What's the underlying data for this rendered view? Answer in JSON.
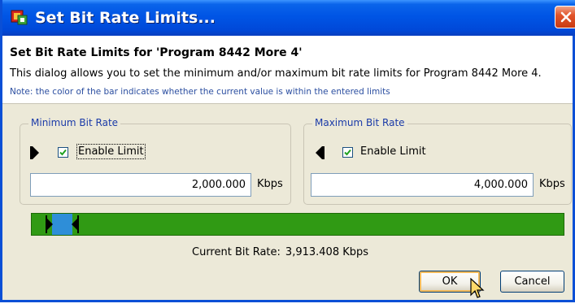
{
  "window": {
    "title": "Set Bit Rate Limits...",
    "app_icon": "app-icon",
    "close_icon": "close-icon"
  },
  "header": {
    "title": "Set Bit Rate Limits for 'Program 8442 More 4'",
    "description": "This dialog allows you to set the minimum and/or maximum bit rate limits for Program 8442 More 4.",
    "note": "Note: the color of the bar indicates whether the current value is within the entered limits"
  },
  "minimum": {
    "legend": "Minimum Bit Rate",
    "marker_icon": "min-marker-icon",
    "enable_label": "Enable Limit",
    "enabled": true,
    "value": "2,000.000",
    "unit": "Kbps"
  },
  "maximum": {
    "legend": "Maximum Bit Rate",
    "marker_icon": "max-marker-icon",
    "enable_label": "Enable Limit",
    "enabled": true,
    "value": "4,000.000",
    "unit": "Kbps"
  },
  "bar": {
    "in_limits_color": "#309a14",
    "range_color": "#2e8ed8"
  },
  "status": {
    "label": "Current Bit Rate:",
    "value": "3,913.408 Kbps"
  },
  "buttons": {
    "ok": "OK",
    "cancel": "Cancel"
  }
}
